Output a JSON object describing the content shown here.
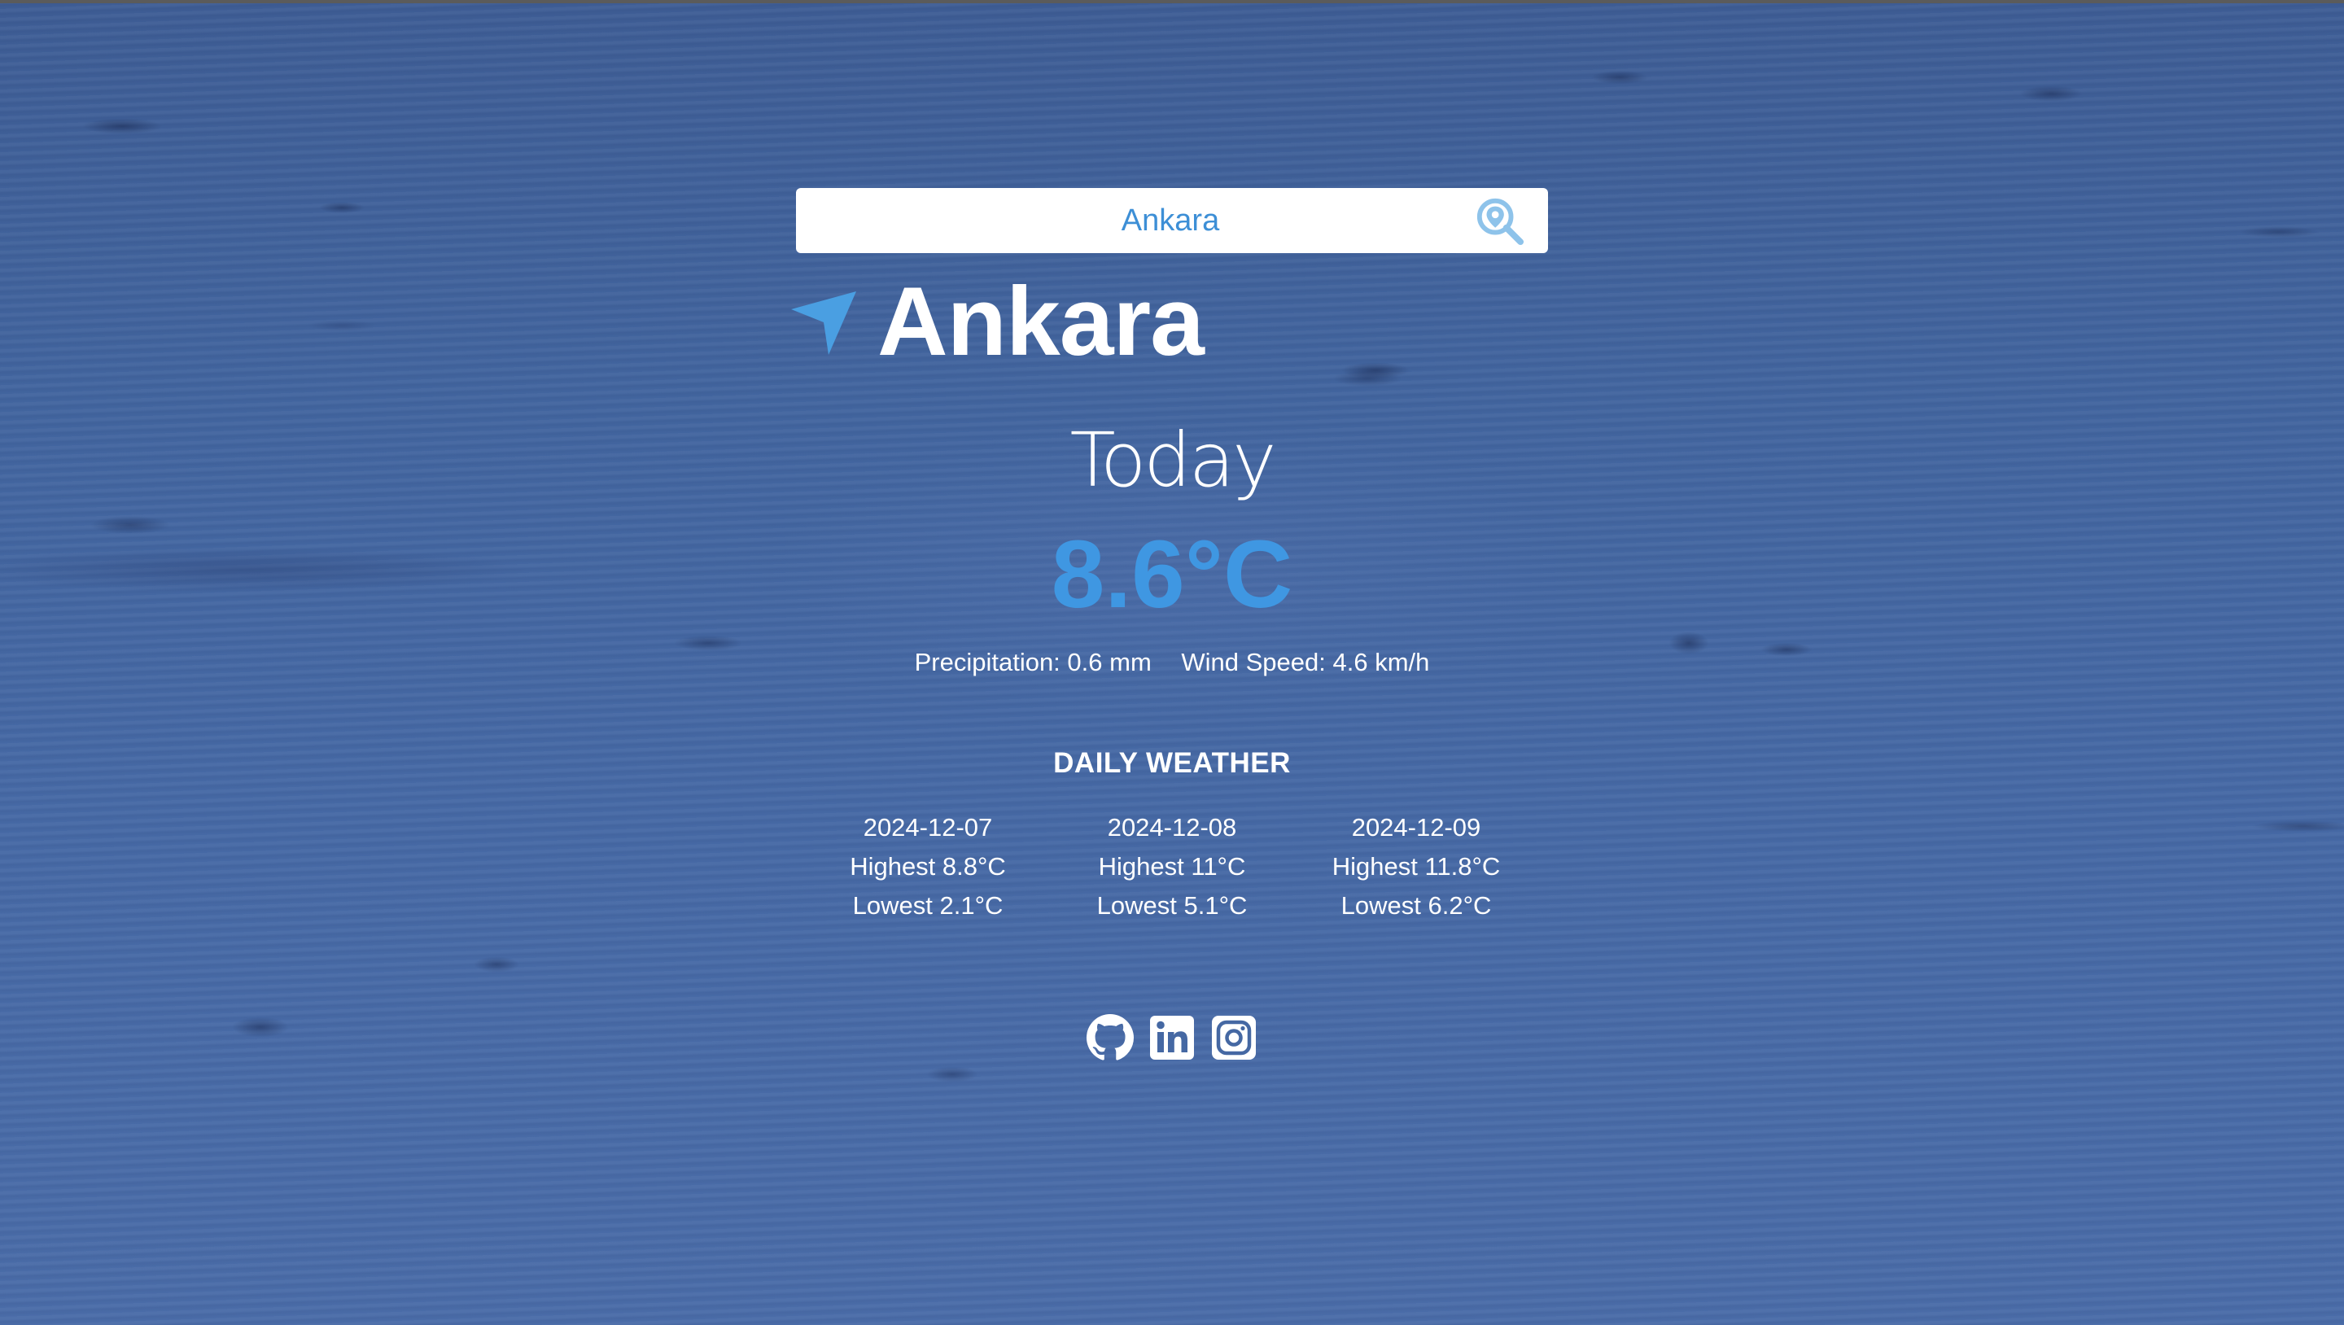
{
  "search": {
    "value": "Ankara",
    "icon": "location-search-icon"
  },
  "location": {
    "icon": "navigation-arrow-icon",
    "city": "Ankara"
  },
  "current": {
    "day_label": "Today",
    "temperature": "8.6°C",
    "precipitation": "Precipitation: 0.6 mm",
    "wind_speed": "Wind Speed: 4.6 km/h"
  },
  "daily": {
    "title": "DAILY WEATHER",
    "days": [
      {
        "date": "2024-12-07",
        "highest": "Highest 8.8°C",
        "lowest": "Lowest 2.1°C"
      },
      {
        "date": "2024-12-08",
        "highest": "Highest 11°C",
        "lowest": "Lowest 5.1°C"
      },
      {
        "date": "2024-12-09",
        "highest": "Highest 11.8°C",
        "lowest": "Lowest 6.2°C"
      }
    ]
  },
  "socials": [
    {
      "icon": "github-icon"
    },
    {
      "icon": "linkedin-icon"
    },
    {
      "icon": "instagram-icon"
    }
  ],
  "colors": {
    "accent": "#3f97e2",
    "search_text": "#3d8fd6",
    "text": "#ffffff",
    "background": "#4568a3"
  }
}
